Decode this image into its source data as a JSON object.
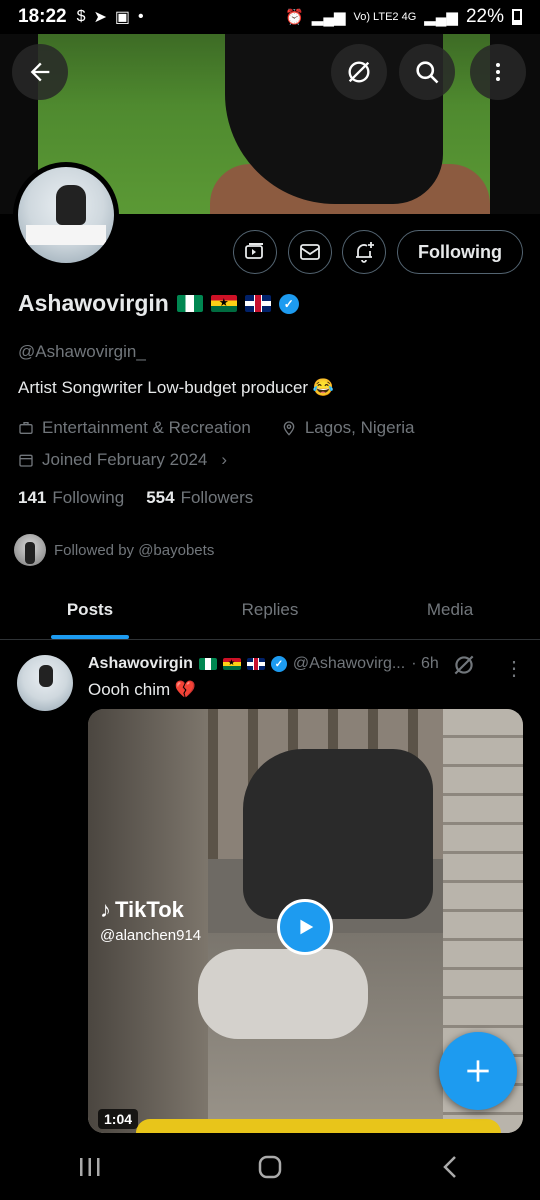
{
  "status_bar": {
    "time": "18:22",
    "battery": "22%",
    "network": "Vo) LTE2 4G"
  },
  "profile": {
    "display_name": "Ashawovirgin",
    "flags": [
      "Nigeria",
      "Ghana",
      "United Kingdom"
    ],
    "verified": true,
    "handle": "@Ashawovirgin_",
    "bio": "Artist Songwriter Low-budget producer 😂",
    "category": "Entertainment & Recreation",
    "location": "Lagos, Nigeria",
    "joined": "Joined February 2024",
    "following_count": "141",
    "following_label": "Following",
    "followers_count": "554",
    "followers_label": "Followers",
    "followed_by": "Followed by @bayobets",
    "follow_button": "Following"
  },
  "tabs": [
    {
      "label": "Posts",
      "active": true
    },
    {
      "label": "Replies",
      "active": false
    },
    {
      "label": "Media",
      "active": false
    }
  ],
  "post": {
    "author": "Ashawovirgin",
    "handle": "@Ashawovirg...",
    "time": "· 6h",
    "text": "Oooh chim 💔",
    "media": {
      "watermark_brand": "TikTok",
      "watermark_account": "@alanchen914",
      "duration": "1:04"
    }
  },
  "colors": {
    "accent": "#1d9bf0",
    "background": "#000000",
    "text_primary": "#e7e9ea",
    "text_secondary": "#71767b",
    "border": "#536471"
  },
  "icons": {
    "back": "back-arrow-icon",
    "grok": "grok-icon",
    "search": "search-icon",
    "more": "more-vertical-icon",
    "subscribe": "subscribe-icon",
    "message": "mail-icon",
    "notify": "bell-plus-icon",
    "compose": "plus-icon"
  }
}
